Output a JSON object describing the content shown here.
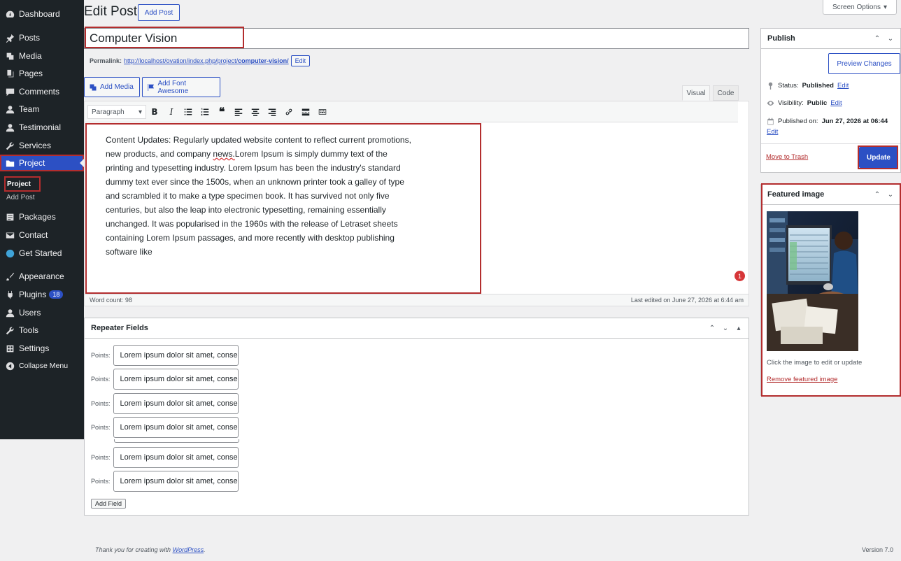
{
  "menu": {
    "dashboard": "Dashboard",
    "posts": "Posts",
    "media": "Media",
    "pages": "Pages",
    "comments": "Comments",
    "team": "Team",
    "testimonial": "Testimonial",
    "services": "Services",
    "project": "Project",
    "sub_project": "Project",
    "sub_add_post": "Add Post",
    "packages": "Packages",
    "contact": "Contact",
    "get_started": "Get Started",
    "appearance": "Appearance",
    "plugins": "Plugins",
    "plugins_badge": "18",
    "users": "Users",
    "tools": "Tools",
    "settings": "Settings",
    "collapse": "Collapse Menu"
  },
  "header": {
    "title": "Edit Post",
    "add_post": "Add Post",
    "screen_options": "Screen Options"
  },
  "post": {
    "title": "Computer Vision",
    "permalink_label": "Permalink:",
    "permalink_base": "http://localhost/ovation/index.php/project/",
    "permalink_slug": "computer-vision/",
    "permalink_edit": "Edit"
  },
  "editor": {
    "add_media": "Add Media",
    "add_font_awesome": "Add Font Awesome",
    "tab_visual": "Visual",
    "tab_code": "Code",
    "format": "Paragraph",
    "content_before": "Content Updates: Regularly updated website content to reflect current promotions, new products, and company ",
    "content_spell": "news.",
    "content_after": "Lorem Ipsum is simply dummy text of the printing and typesetting industry. Lorem Ipsum has been the industry's standard dummy text ever since the 1500s, when an unknown printer took a galley of type and scrambled it to make a type specimen book. It has survived not only five centuries, but also the leap into electronic typesetting, remaining essentially unchanged. It was popularised in the 1960s with the release of Letraset sheets containing Lorem Ipsum passages, and more recently with desktop publishing software like",
    "word_count": "Word count: 98",
    "last_edited": "Last edited on June 27, 2026 at 6:44 am",
    "notification_count": "1"
  },
  "repeater": {
    "title": "Repeater Fields",
    "label": "Points:",
    "values": [
      "Lorem ipsum dolor sit amet, consectetur",
      "Lorem ipsum dolor sit amet, consectetur",
      "Lorem ipsum dolor sit amet, consectetur",
      "Lorem ipsum dolor sit amet, consectetur",
      "Lorem ipsum dolor sit amet, consectetur",
      "Lorem ipsum dolor sit amet, consectetur"
    ],
    "add_field": "Add Field"
  },
  "publish": {
    "title": "Publish",
    "preview": "Preview Changes",
    "status_label": "Status:",
    "status_value": "Published",
    "visibility_label": "Visibility:",
    "visibility_value": "Public",
    "published_label": "Published on:",
    "published_value": "Jun 27, 2026 at 06:44",
    "edit": "Edit",
    "trash": "Move to Trash",
    "update": "Update"
  },
  "featured": {
    "title": "Featured image",
    "hint": "Click the image to edit or update",
    "remove": "Remove featured image"
  },
  "footer": {
    "thanks": "Thank you for creating with",
    "wordpress": "WordPress",
    "version": "Version 7.0"
  },
  "colors": {
    "accent": "#2c50c4",
    "highlight": "#b32d2e",
    "menu_bg": "#1d2327"
  }
}
